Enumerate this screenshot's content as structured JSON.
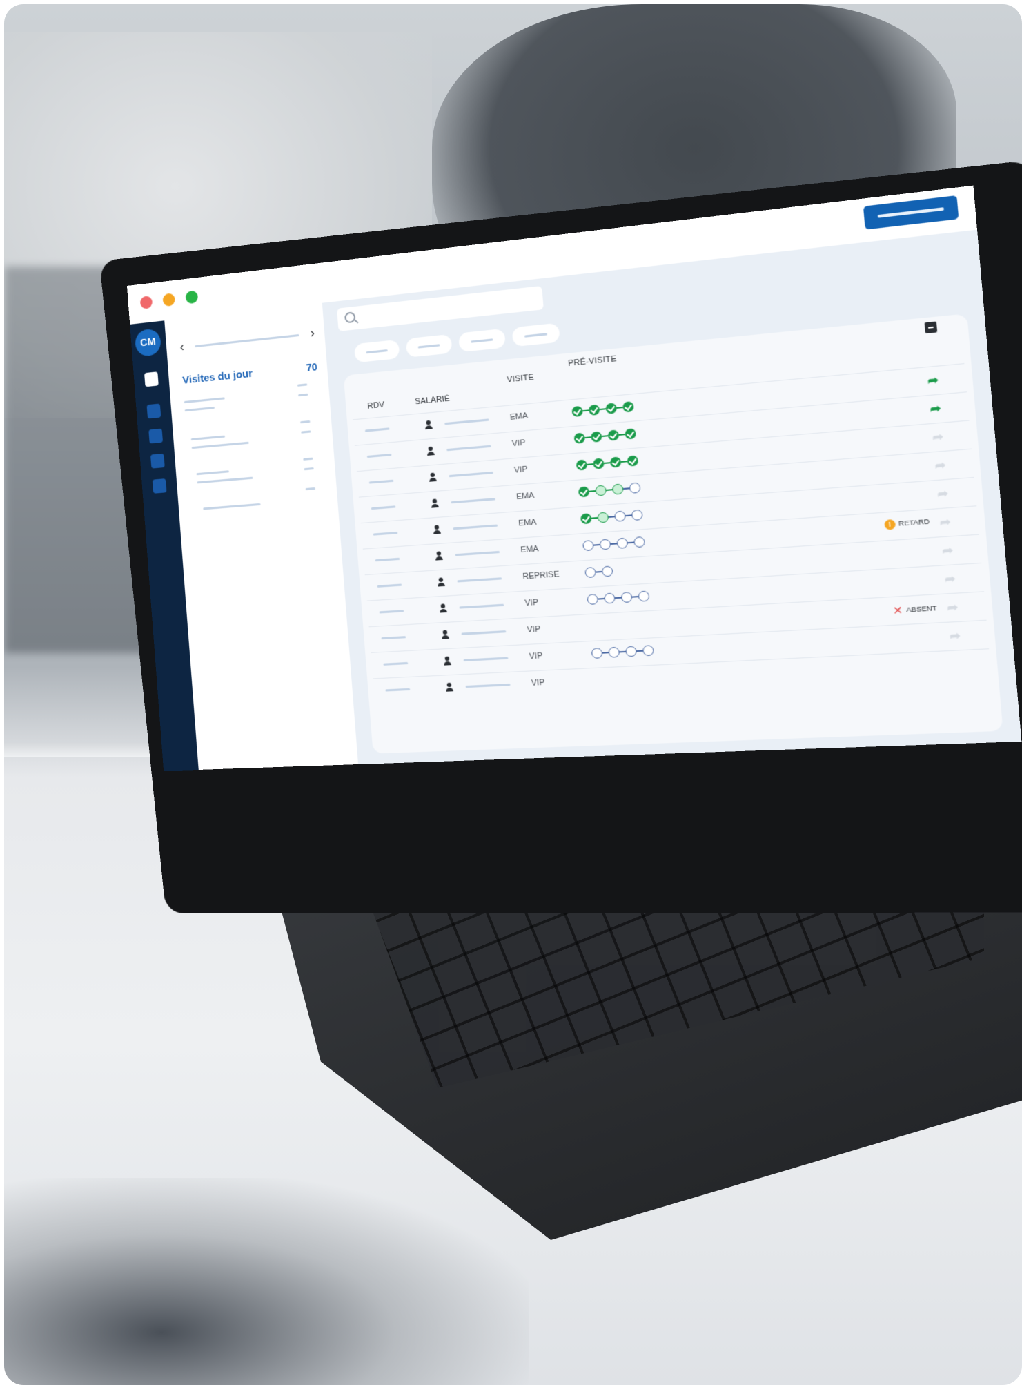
{
  "window": {
    "title_dots": [
      "close",
      "minimize",
      "maximize"
    ]
  },
  "brand": {
    "logo_text": "CM",
    "accent": "#1262b3",
    "sidebar_bg": "#0d2542"
  },
  "left_panel": {
    "title": "Visites du jour",
    "count": "70"
  },
  "table": {
    "headers": {
      "rdv": "RDV",
      "salarie": "SALARIÉ",
      "visite": "VISITE",
      "previsite": "PRÉ-VISITE"
    },
    "rows": [
      {
        "visite": "EMA",
        "previsite": [
          "done",
          "done",
          "done",
          "done"
        ],
        "status": "",
        "action": "share"
      },
      {
        "visite": "VIP",
        "previsite": [
          "done",
          "done",
          "done",
          "done"
        ],
        "status": "",
        "action": "share"
      },
      {
        "visite": "VIP",
        "previsite": [
          "done",
          "done",
          "done",
          "done"
        ],
        "status": "",
        "action": "faint"
      },
      {
        "visite": "EMA",
        "previsite": [
          "done",
          "light",
          "light",
          "open"
        ],
        "status": "",
        "action": "faint"
      },
      {
        "visite": "EMA",
        "previsite": [
          "done",
          "light",
          "open",
          "open"
        ],
        "status": "",
        "action": "faint"
      },
      {
        "visite": "EMA",
        "previsite": [
          "open",
          "open",
          "open",
          "open"
        ],
        "status": "RETARD",
        "action": "faint"
      },
      {
        "visite": "REPRISE",
        "previsite": [
          "open",
          "open"
        ],
        "status": "",
        "action": "faint"
      },
      {
        "visite": "VIP",
        "previsite": [
          "open",
          "open",
          "open",
          "open"
        ],
        "status": "",
        "action": "faint"
      },
      {
        "visite": "VIP",
        "previsite": [],
        "status": "ABSENT",
        "action": "faint"
      },
      {
        "visite": "VIP",
        "previsite": [
          "open",
          "open",
          "open",
          "open"
        ],
        "status": "",
        "action": "faint"
      },
      {
        "visite": "VIP",
        "previsite": [],
        "status": "",
        "action": "none"
      }
    ]
  },
  "colors": {
    "done": "#1a9b4a",
    "open": "#4c6aa4",
    "retard": "#f5a623",
    "absent": "#e24a4a"
  }
}
